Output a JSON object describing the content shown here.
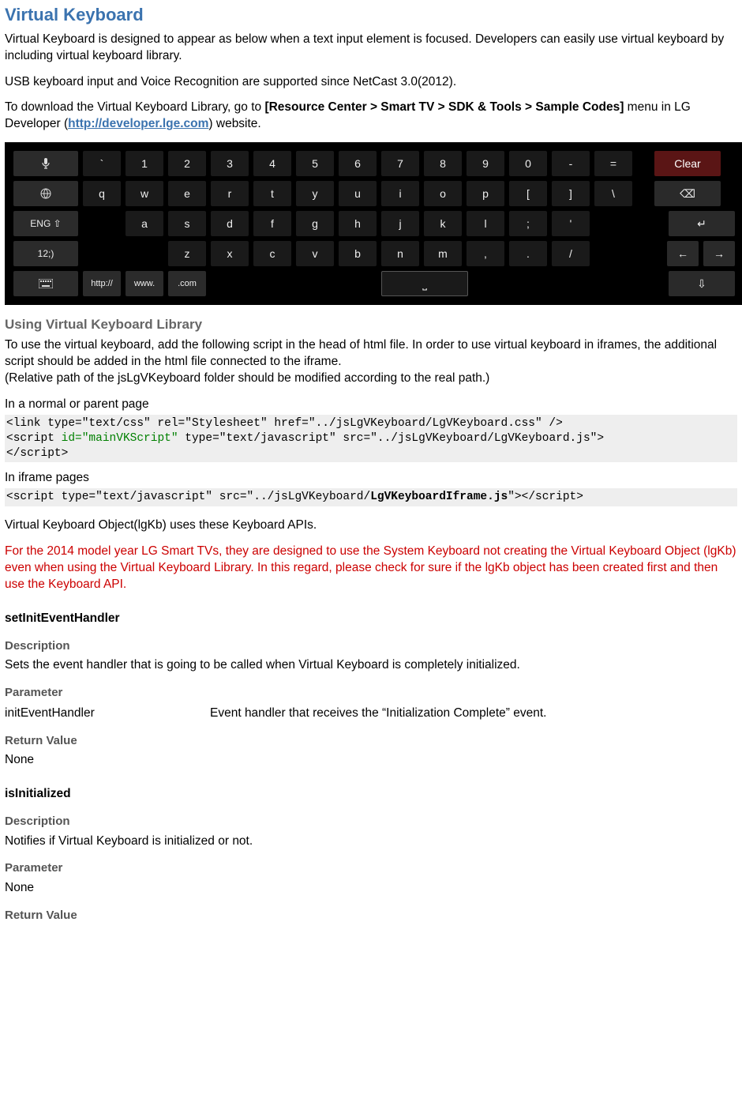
{
  "title": "Virtual Keyboard",
  "intro1": "Virtual Keyboard is designed to appear as below when a text input element is focused. Developers can easily use virtual keyboard by including virtual keyboard library.",
  "intro2": "USB keyboard input and Voice Recognition are supported since NetCast 3.0(2012).",
  "intro3_prefix": "To download the Virtual Keyboard Library, go to ",
  "intro3_path": "[Resource Center > Smart TV > SDK & Tools > Sample Codes]",
  "intro3_mid": " menu in LG Developer (",
  "intro3_link": "http://developer.lge.com",
  "intro3_suffix": ") website.",
  "keyboard": {
    "side_labels": [
      "mic",
      "globe",
      "ENG ⇧",
      "12;)",
      "kbd"
    ],
    "row1": [
      "`",
      "1",
      "2",
      "3",
      "4",
      "5",
      "6",
      "7",
      "8",
      "9",
      "0",
      "-",
      "="
    ],
    "row2": [
      "q",
      "w",
      "e",
      "r",
      "t",
      "y",
      "u",
      "i",
      "o",
      "p",
      "[",
      "]",
      "\\"
    ],
    "row3": [
      "a",
      "s",
      "d",
      "f",
      "g",
      "h",
      "j",
      "k",
      "l",
      ";",
      "'"
    ],
    "row4": [
      "z",
      "x",
      "c",
      "v",
      "b",
      "n",
      "m",
      ",",
      ".",
      "/"
    ],
    "url_keys": [
      "http://",
      "www.",
      ".com"
    ],
    "action_clear": "Clear",
    "action_back": "⌫",
    "action_enter": "↵",
    "action_left": "←",
    "action_right": "→",
    "action_down": "⇩"
  },
  "using_heading": "Using Virtual Keyboard Library",
  "using_p1_l1": "To use the virtual keyboard, add the following script in the head of html file. In order to use virtual keyboard in iframes, the additional script should be added in the html file connected to the iframe.",
  "using_p1_l2": "(Relative path of the jsLgVKeyboard folder should be modified according to the real path.)",
  "code1_label": "In a normal or parent page",
  "code1_line1": "<link type=\"text/css\" rel=\"Stylesheet\" href=\"../jsLgVKeyboard/LgVKeyboard.css\" />",
  "code1_line2a": "<script ",
  "code1_line2b": "id=\"mainVKScript\"",
  "code1_line2c": " type=\"text/javascript\" src=\"../jsLgVKeyboard/LgVKeyboard.js\">",
  "code1_line3": "</script>",
  "code2_label": "In iframe pages",
  "code2_a": "<script type=\"text/javascript\" src=\"../jsLgVKeyboard/",
  "code2_b": "LgVKeyboardIframe.js",
  "code2_c": "\"></script>",
  "obj_note": "Virtual Keyboard Object(lgKb) uses these Keyboard APIs.",
  "red_note": "For the 2014 model year LG Smart TVs, they are designed to use the System Keyboard not creating the Virtual Keyboard Object (lgKb) even when using the Virtual Keyboard Library. In this regard, please check for sure if the lgKb object has been created first and then use the Keyboard API.",
  "api": {
    "setInitEventHandler": {
      "name": "setInitEventHandler",
      "desc_label": "Description",
      "desc": "Sets the event handler that is going to be called when Virtual Keyboard is completely initialized.",
      "param_label": "Parameter",
      "param_name": "initEventHandler",
      "param_desc": "Event handler that receives the “Initialization Complete” event.",
      "ret_label": "Return Value",
      "ret": "None"
    },
    "isInitialized": {
      "name": "isInitialized",
      "desc_label": "Description",
      "desc": "Notifies if Virtual Keyboard is initialized or not.",
      "param_label": "Parameter",
      "param": "None",
      "ret_label": "Return Value"
    }
  }
}
